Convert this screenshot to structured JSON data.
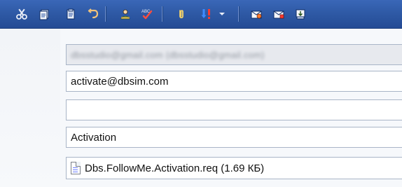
{
  "toolbar": {
    "icons": [
      {
        "name": "cut-icon"
      },
      {
        "name": "copy-icon"
      },
      {
        "name": "paste-icon"
      },
      {
        "name": "undo-icon"
      },
      {
        "name": "address-book-icon"
      },
      {
        "name": "spellcheck-icon"
      },
      {
        "name": "attach-icon"
      },
      {
        "name": "priority-icon"
      },
      {
        "name": "dropdown-arrow-icon"
      },
      {
        "name": "sign-icon"
      },
      {
        "name": "encrypt-icon"
      },
      {
        "name": "offline-icon"
      }
    ]
  },
  "fields": {
    "from": {
      "value": "dbsstudio@gmail.com   (dbsstudio@gmail.com)"
    },
    "to": {
      "value": "activate@dbsim.com"
    },
    "cc": {
      "value": ""
    },
    "subject": {
      "value": "Activation"
    },
    "attachment": {
      "value": "Dbs.FollowMe.Activation.req (1.69 КБ)"
    }
  }
}
